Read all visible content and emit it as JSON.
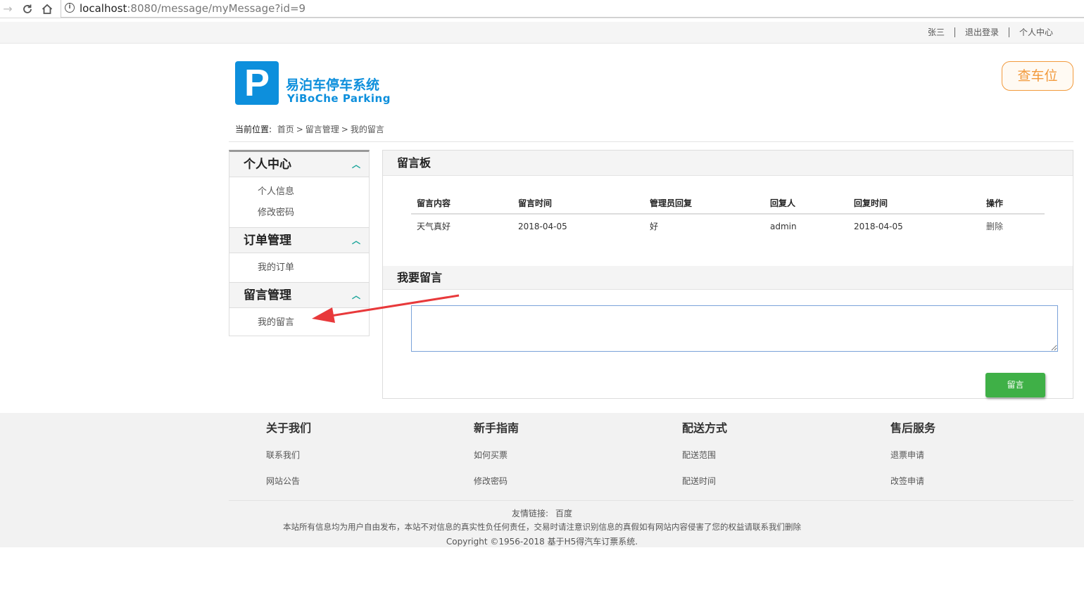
{
  "browser": {
    "url_host": "localhost",
    "url_rest": ":8080/message/myMessage?id=9"
  },
  "topbar": {
    "user": "张三",
    "logout": "退出登录",
    "center": "个人中心"
  },
  "header": {
    "logo_letter": "P",
    "logo_title": "易泊车停车系统",
    "logo_subtitle": "YiBoChe  Parking",
    "find_button": "查车位",
    "brand_color": "#0d8fdc"
  },
  "breadcrumb": {
    "label": "当前位置:",
    "items": [
      "首页",
      "留言管理",
      "我的留言"
    ],
    "separator": ">"
  },
  "sidebar": {
    "groups": [
      {
        "title": "个人中心",
        "items": [
          "个人信息",
          "修改密码"
        ]
      },
      {
        "title": "订单管理",
        "items": [
          "我的订单"
        ]
      },
      {
        "title": "留言管理",
        "items": [
          "我的留言"
        ]
      }
    ]
  },
  "board": {
    "title": "留言板",
    "columns": [
      "留言内容",
      "留言时间",
      "管理员回复",
      "回复人",
      "回复时间",
      "操作"
    ],
    "rows": [
      [
        "天气真好",
        "2018-04-05",
        "好",
        "admin",
        "2018-04-05",
        "删除"
      ]
    ]
  },
  "compose": {
    "title": "我要留言",
    "value": "",
    "submit_label": "留言",
    "submit_color": "#3fb047"
  },
  "footer": {
    "columns": [
      {
        "title": "关于我们",
        "links": [
          "联系我们",
          "网站公告"
        ]
      },
      {
        "title": "新手指南",
        "links": [
          "如何买票",
          "修改密码"
        ]
      },
      {
        "title": "配送方式",
        "links": [
          "配送范围",
          "配送时间"
        ]
      },
      {
        "title": "售后服务",
        "links": [
          "退票申请",
          "改签申请"
        ]
      }
    ],
    "friend_label": "友情链接:",
    "friend_link": "百度",
    "disclaimer": "本站所有信息均为用户自由发布，本站不对信息的真实性负任何责任，交易时请注意识别信息的真假如有网站内容侵害了您的权益请联系我们删除",
    "copyright": "Copyright ©1956-2018 基于H5得汽车订票系统."
  },
  "annotation": {
    "icon": "red-arrow-icon",
    "color": "#e8393b"
  }
}
